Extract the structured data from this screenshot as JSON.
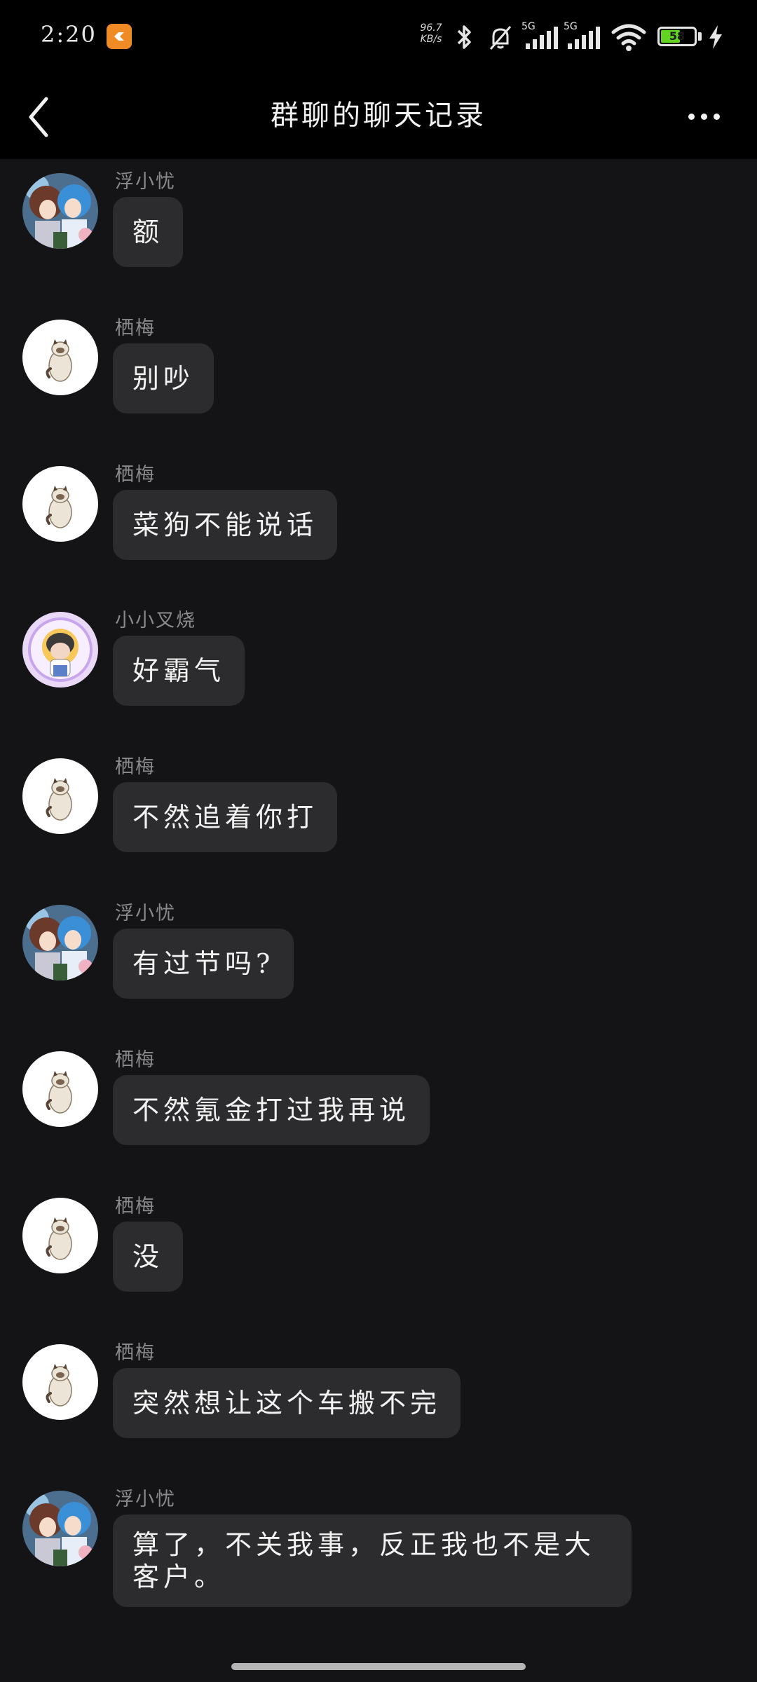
{
  "status_bar": {
    "time": "2:20",
    "net_speed_value": "96.7",
    "net_speed_unit": "KB/s",
    "signal_1_label": "5G",
    "signal_2_label": "5G",
    "battery_level": "58",
    "battery_fraction": 0.58,
    "battery_color": "#61d320",
    "icons": [
      "app-notification-icon",
      "bluetooth-icon",
      "silent-bell-icon",
      "signal-icon",
      "signal-icon",
      "wifi-icon",
      "battery-icon",
      "charging-icon"
    ]
  },
  "nav": {
    "title": "群聊的聊天记录",
    "back_icon": "chevron-left-icon",
    "more_icon": "more-dots-icon"
  },
  "messages": [
    {
      "sender": "浮小忧",
      "text": "额",
      "avatar": "anime-duo"
    },
    {
      "sender": "栖梅",
      "text": "别吵",
      "avatar": "cat"
    },
    {
      "sender": "栖梅",
      "text": "菜狗不能说话",
      "avatar": "cat"
    },
    {
      "sender": "小小叉烧",
      "text": "好霸气",
      "avatar": "chibi"
    },
    {
      "sender": "栖梅",
      "text": "不然追着你打",
      "avatar": "cat"
    },
    {
      "sender": "浮小忧",
      "text": "有过节吗?",
      "avatar": "anime-duo"
    },
    {
      "sender": "栖梅",
      "text": "不然氪金打过我再说",
      "avatar": "cat"
    },
    {
      "sender": "栖梅",
      "text": "没",
      "avatar": "cat"
    },
    {
      "sender": "栖梅",
      "text": "突然想让这个车搬不完",
      "avatar": "cat"
    },
    {
      "sender": "浮小忧",
      "text": "算了，不关我事，反正我也不是大客户。",
      "avatar": "anime-duo"
    }
  ]
}
